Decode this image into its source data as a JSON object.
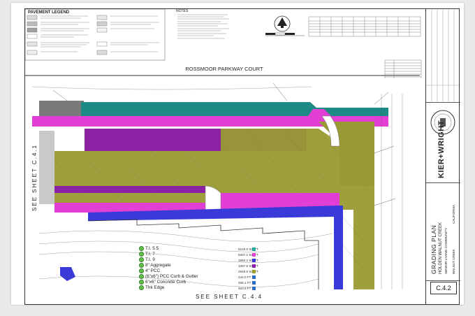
{
  "legend": {
    "title": "PAVEMENT LEGEND"
  },
  "notes": {
    "title": "NOTES"
  },
  "street": {
    "name": "ROSSMOOR PARKWAY COURT"
  },
  "match_lines": {
    "left": "SEE SHEET C.4.1",
    "bottom": "SEE SHEET C.4.4"
  },
  "quantities": {
    "items": [
      {
        "label": "T.I. 5.5",
        "value": "5225.0 SQ.FT",
        "color": "#1ea99a"
      },
      {
        "label": "T.I. 7",
        "value": "8287.1 SQ.FT",
        "color": "#e040d0"
      },
      {
        "label": "T.I. 9",
        "value": "1894.2 SQ.FT",
        "color": "#3a3ad8"
      },
      {
        "label": "8\" Aggregate",
        "value": "1067.5 SQ.FT",
        "color": "#8b1fb0"
      },
      {
        "label": "4\" PCC",
        "value": "2948.9 SQ.FT",
        "color": "#9c9c2a"
      },
      {
        "label": "(6\"x6\") PCC Curb & Gutter",
        "value": "244.0 FT",
        "color": "#2a6ac8"
      },
      {
        "label": "6\"x6\" Concrete Curb",
        "value": "486.1 FT",
        "color": "#2a6ac8"
      },
      {
        "label": "Thk Edge",
        "value": "463.8 FT",
        "color": "#2a6ac8"
      }
    ]
  },
  "title_block": {
    "firm": "KIER+WRIGHT",
    "sheet_title": "GRADING PLAN",
    "project": "HOLDEN WALNUT CREEK",
    "subtitle": "SENIOR LIVING COMMUNITY",
    "city": "WALNUT CREEK",
    "state": "CALIFORNIA",
    "sheet_number": "C.4.2"
  }
}
